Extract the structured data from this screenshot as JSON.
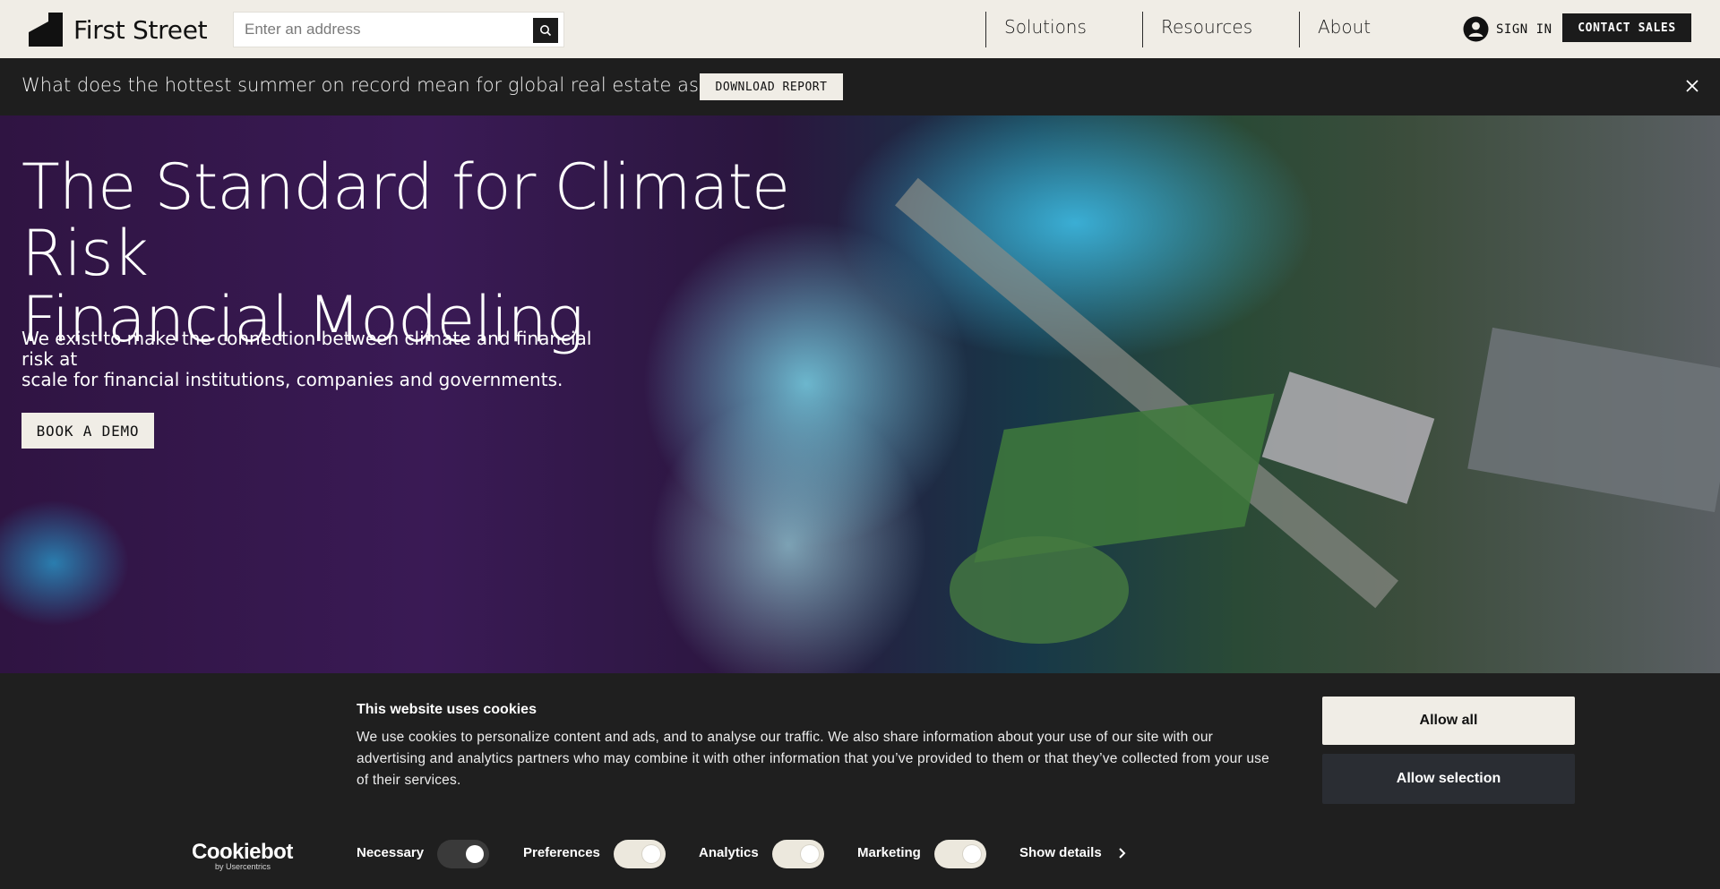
{
  "nav": {
    "brand": "First Street",
    "search_placeholder": "Enter an address",
    "links": [
      "Solutions",
      "Resources",
      "About"
    ],
    "signin": "SIGN IN",
    "contact": "CONTACT SALES"
  },
  "banner": {
    "text": "What does the hottest summer on record mean for global real estate assets?",
    "button": "DOWNLOAD REPORT"
  },
  "hero": {
    "title_line1": "The Standard for Climate Risk",
    "title_line2": "Financial Modeling",
    "subtitle_line1": "We exist to make the connection between climate and financial risk at",
    "subtitle_line2": "scale for financial institutions, companies and governments.",
    "cta": "BOOK A DEMO"
  },
  "cookie": {
    "title": "This website uses cookies",
    "body_line1": "We use cookies to personalize content and ads, and to analyse our traffic. We also share information about your use of our site with our",
    "body_line2": "advertising and analytics partners who may combine it with other information that you’ve provided to them or that they’ve collected from your use",
    "body_line3": "of their services.",
    "allow_all": "Allow all",
    "allow_selection": "Allow selection",
    "brand_main": "Cookiebot",
    "brand_sub": "by Usercentrics",
    "toggles": [
      {
        "label": "Necessary",
        "on": true
      },
      {
        "label": "Preferences",
        "on": true
      },
      {
        "label": "Analytics",
        "on": true
      },
      {
        "label": "Marketing",
        "on": true
      }
    ],
    "show_details": "Show details"
  },
  "colors": {
    "nav_bg": "#f0ede6",
    "dark": "#1e1e1e",
    "hero_purple": "#3a1a55",
    "cyan": "#3cb4dc"
  }
}
